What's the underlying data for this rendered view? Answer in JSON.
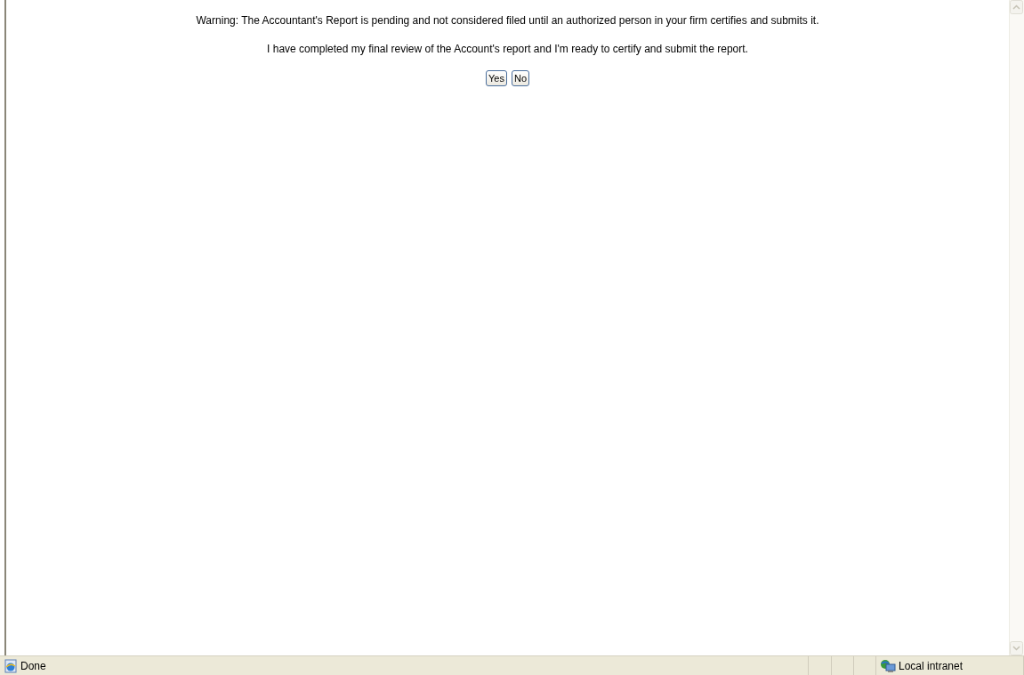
{
  "message": {
    "warning": "Warning: The Accountant's Report is pending and not considered filed until an authorized person in your firm certifies and submits it.",
    "question": "I have completed my final review of the Account's report and I'm ready to certify and submit the report."
  },
  "buttons": [
    {
      "label": "Yes"
    },
    {
      "label": "No"
    }
  ],
  "status_bar": {
    "text": "Done",
    "zone": "Local intranet"
  }
}
